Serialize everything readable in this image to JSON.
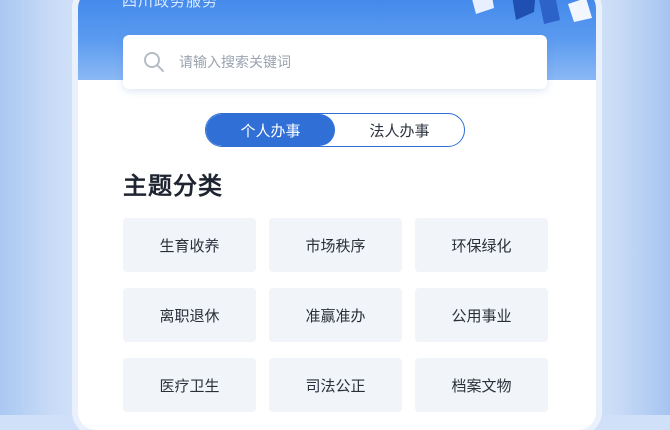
{
  "banner": {
    "title": "四川政务服务"
  },
  "search": {
    "placeholder": "请输入搜索关键词"
  },
  "tabs": [
    {
      "label": "个人办事",
      "active": true
    },
    {
      "label": "法人办事",
      "active": false
    }
  ],
  "section": {
    "title": "主题分类"
  },
  "categories": [
    "生育收养",
    "市场秩序",
    "环保绿化",
    "离职退休",
    "准赢准办",
    "公用事业",
    "医疗卫生",
    "司法公正",
    "档案文物"
  ],
  "colors": {
    "accent": "#2f6fd6",
    "banner": "#4a8eec",
    "tile_bg": "#f1f4f8"
  }
}
